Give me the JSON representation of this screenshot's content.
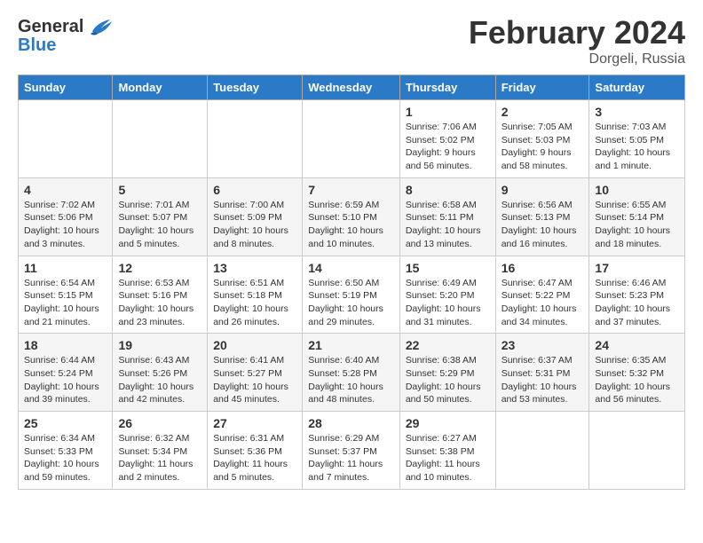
{
  "header": {
    "logo_text_general": "General",
    "logo_text_blue": "Blue",
    "month_title": "February 2024",
    "location": "Dorgeli, Russia"
  },
  "calendar": {
    "weekdays": [
      "Sunday",
      "Monday",
      "Tuesday",
      "Wednesday",
      "Thursday",
      "Friday",
      "Saturday"
    ],
    "weeks": [
      [
        {
          "day": "",
          "info": ""
        },
        {
          "day": "",
          "info": ""
        },
        {
          "day": "",
          "info": ""
        },
        {
          "day": "",
          "info": ""
        },
        {
          "day": "1",
          "info": "Sunrise: 7:06 AM\nSunset: 5:02 PM\nDaylight: 9 hours and 56 minutes."
        },
        {
          "day": "2",
          "info": "Sunrise: 7:05 AM\nSunset: 5:03 PM\nDaylight: 9 hours and 58 minutes."
        },
        {
          "day": "3",
          "info": "Sunrise: 7:03 AM\nSunset: 5:05 PM\nDaylight: 10 hours and 1 minute."
        }
      ],
      [
        {
          "day": "4",
          "info": "Sunrise: 7:02 AM\nSunset: 5:06 PM\nDaylight: 10 hours and 3 minutes."
        },
        {
          "day": "5",
          "info": "Sunrise: 7:01 AM\nSunset: 5:07 PM\nDaylight: 10 hours and 5 minutes."
        },
        {
          "day": "6",
          "info": "Sunrise: 7:00 AM\nSunset: 5:09 PM\nDaylight: 10 hours and 8 minutes."
        },
        {
          "day": "7",
          "info": "Sunrise: 6:59 AM\nSunset: 5:10 PM\nDaylight: 10 hours and 10 minutes."
        },
        {
          "day": "8",
          "info": "Sunrise: 6:58 AM\nSunset: 5:11 PM\nDaylight: 10 hours and 13 minutes."
        },
        {
          "day": "9",
          "info": "Sunrise: 6:56 AM\nSunset: 5:13 PM\nDaylight: 10 hours and 16 minutes."
        },
        {
          "day": "10",
          "info": "Sunrise: 6:55 AM\nSunset: 5:14 PM\nDaylight: 10 hours and 18 minutes."
        }
      ],
      [
        {
          "day": "11",
          "info": "Sunrise: 6:54 AM\nSunset: 5:15 PM\nDaylight: 10 hours and 21 minutes."
        },
        {
          "day": "12",
          "info": "Sunrise: 6:53 AM\nSunset: 5:16 PM\nDaylight: 10 hours and 23 minutes."
        },
        {
          "day": "13",
          "info": "Sunrise: 6:51 AM\nSunset: 5:18 PM\nDaylight: 10 hours and 26 minutes."
        },
        {
          "day": "14",
          "info": "Sunrise: 6:50 AM\nSunset: 5:19 PM\nDaylight: 10 hours and 29 minutes."
        },
        {
          "day": "15",
          "info": "Sunrise: 6:49 AM\nSunset: 5:20 PM\nDaylight: 10 hours and 31 minutes."
        },
        {
          "day": "16",
          "info": "Sunrise: 6:47 AM\nSunset: 5:22 PM\nDaylight: 10 hours and 34 minutes."
        },
        {
          "day": "17",
          "info": "Sunrise: 6:46 AM\nSunset: 5:23 PM\nDaylight: 10 hours and 37 minutes."
        }
      ],
      [
        {
          "day": "18",
          "info": "Sunrise: 6:44 AM\nSunset: 5:24 PM\nDaylight: 10 hours and 39 minutes."
        },
        {
          "day": "19",
          "info": "Sunrise: 6:43 AM\nSunset: 5:26 PM\nDaylight: 10 hours and 42 minutes."
        },
        {
          "day": "20",
          "info": "Sunrise: 6:41 AM\nSunset: 5:27 PM\nDaylight: 10 hours and 45 minutes."
        },
        {
          "day": "21",
          "info": "Sunrise: 6:40 AM\nSunset: 5:28 PM\nDaylight: 10 hours and 48 minutes."
        },
        {
          "day": "22",
          "info": "Sunrise: 6:38 AM\nSunset: 5:29 PM\nDaylight: 10 hours and 50 minutes."
        },
        {
          "day": "23",
          "info": "Sunrise: 6:37 AM\nSunset: 5:31 PM\nDaylight: 10 hours and 53 minutes."
        },
        {
          "day": "24",
          "info": "Sunrise: 6:35 AM\nSunset: 5:32 PM\nDaylight: 10 hours and 56 minutes."
        }
      ],
      [
        {
          "day": "25",
          "info": "Sunrise: 6:34 AM\nSunset: 5:33 PM\nDaylight: 10 hours and 59 minutes."
        },
        {
          "day": "26",
          "info": "Sunrise: 6:32 AM\nSunset: 5:34 PM\nDaylight: 11 hours and 2 minutes."
        },
        {
          "day": "27",
          "info": "Sunrise: 6:31 AM\nSunset: 5:36 PM\nDaylight: 11 hours and 5 minutes."
        },
        {
          "day": "28",
          "info": "Sunrise: 6:29 AM\nSunset: 5:37 PM\nDaylight: 11 hours and 7 minutes."
        },
        {
          "day": "29",
          "info": "Sunrise: 6:27 AM\nSunset: 5:38 PM\nDaylight: 11 hours and 10 minutes."
        },
        {
          "day": "",
          "info": ""
        },
        {
          "day": "",
          "info": ""
        }
      ]
    ]
  }
}
